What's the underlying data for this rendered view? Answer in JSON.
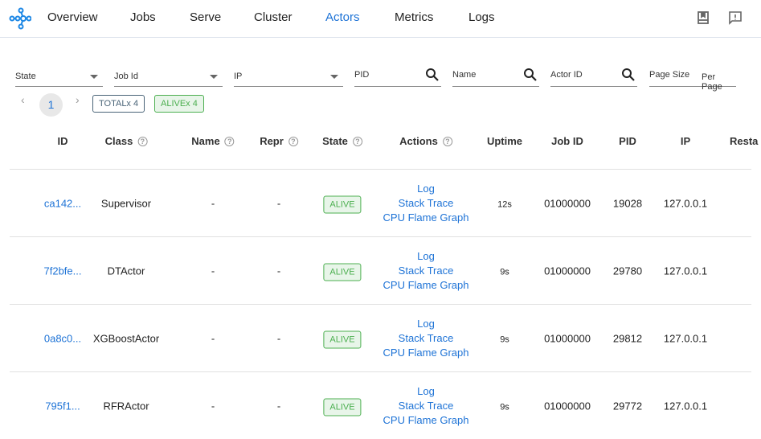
{
  "nav": {
    "items": [
      "Overview",
      "Jobs",
      "Serve",
      "Cluster",
      "Actors",
      "Metrics",
      "Logs"
    ],
    "active": "Actors",
    "icons": [
      "docs-book-icon",
      "feedback-icon"
    ]
  },
  "filters": {
    "state": "State",
    "job_id": "Job Id",
    "ip": "IP",
    "pid": "PID",
    "name": "Name",
    "actor_id": "Actor ID",
    "page_size": "Page Size",
    "per_page": "Per Page"
  },
  "pagination": {
    "prev": "‹",
    "page": "1",
    "next": "›"
  },
  "chips": {
    "total": "TOTALx 4",
    "alive": "ALIVEx 4"
  },
  "columns": [
    "ID",
    "Class",
    "Name",
    "Repr",
    "State",
    "Actions",
    "Uptime",
    "Job ID",
    "PID",
    "IP",
    "Resta"
  ],
  "actions": [
    "Log",
    "Stack Trace",
    "CPU Flame Graph"
  ],
  "rows": [
    {
      "id": "ca142...",
      "class": "Supervisor",
      "name": "-",
      "repr": "-",
      "state": "ALIVE",
      "uptime": "12s",
      "job_id": "01000000",
      "pid": "19028",
      "ip": "127.0.0.1"
    },
    {
      "id": "7f2bfe...",
      "class": "DTActor",
      "name": "-",
      "repr": "-",
      "state": "ALIVE",
      "uptime": "9s",
      "job_id": "01000000",
      "pid": "29780",
      "ip": "127.0.0.1"
    },
    {
      "id": "0a8c0...",
      "class": "XGBoostActor",
      "name": "-",
      "repr": "-",
      "state": "ALIVE",
      "uptime": "9s",
      "job_id": "01000000",
      "pid": "29812",
      "ip": "127.0.0.1"
    },
    {
      "id": "795f1...",
      "class": "RFRActor",
      "name": "-",
      "repr": "-",
      "state": "ALIVE",
      "uptime": "9s",
      "job_id": "01000000",
      "pid": "29772",
      "ip": "127.0.0.1"
    }
  ],
  "colors": {
    "accent": "#1e73d6",
    "alive": "#4caf50"
  }
}
